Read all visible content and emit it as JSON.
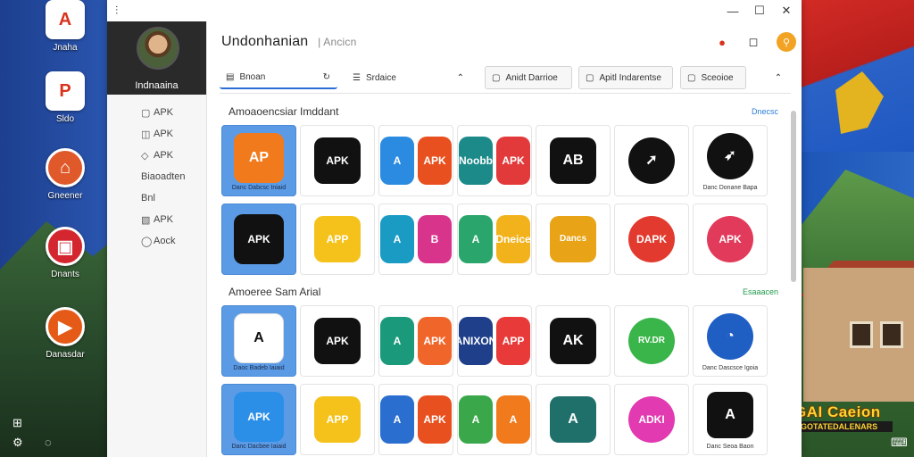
{
  "desktop": {
    "icons": [
      {
        "name": "desktop-icon-apk",
        "glyph": "A",
        "label": "Jnaha",
        "color": "#d9331e"
      },
      {
        "name": "desktop-icon-ap",
        "glyph": "P",
        "label": "Sldo",
        "color": "#d9331e"
      },
      {
        "name": "desktop-icon-store",
        "glyph": "⌂",
        "label": "Gneener",
        "color": "#e0592b"
      },
      {
        "name": "desktop-icon-box",
        "glyph": "▣",
        "label": "Dnants",
        "color": "#d3262f"
      },
      {
        "name": "desktop-icon-play",
        "glyph": "▶",
        "label": "Danasdar",
        "color": "#e55a17"
      }
    ],
    "caption": "AIGAI Caeion",
    "caption_sub": "IMANGOTATEDALENARS"
  },
  "window": {
    "title_glyph": "⫶",
    "controls": {
      "minimize": "—",
      "maximize": "☐",
      "close": "✕"
    }
  },
  "sidebar": {
    "user_name": "Indnaaina",
    "items": [
      {
        "icon": "▢",
        "label": "APK"
      },
      {
        "icon": "◫",
        "label": "APK"
      },
      {
        "icon": "◇",
        "label": "APK"
      },
      {
        "icon": "",
        "label": "Biaoadten"
      },
      {
        "icon": "",
        "label": "Bnl"
      },
      {
        "icon": "▧",
        "label": "APK"
      },
      {
        "icon": "◯",
        "label": "Aock"
      }
    ]
  },
  "header": {
    "title": "Undonhanian",
    "subtitle": "| Ancicn",
    "icons": {
      "notification": "●",
      "bell": "◻",
      "user": "⚲"
    }
  },
  "toolbar": {
    "tabs": [
      {
        "icon": "▤",
        "label": "Bnoan",
        "trail": "↻"
      },
      {
        "icon": "☰",
        "label": "Srdaice",
        "trail": "⌃"
      },
      {
        "icon": "▢",
        "label": "Anidt Darrioe",
        "trail": ""
      },
      {
        "icon": "▢",
        "label": "Apitl Indarentse",
        "trail": ""
      },
      {
        "icon": "▢",
        "label": "Sceoioe",
        "trail": ""
      }
    ],
    "collapse": "⌃"
  },
  "sections": [
    {
      "title": "Amoaoencsiar Imddant",
      "link": "Dnecsc",
      "rows": [
        [
          {
            "type": "featured",
            "text": "AP",
            "bg": "#f07a1c",
            "cap": "Danc Dabcsc Iniaid"
          },
          {
            "type": "icon",
            "text": "APK",
            "bg": "#111111"
          },
          {
            "type": "pair",
            "a": {
              "text": "A",
              "bg": "#2a8be0"
            },
            "b": {
              "text": "APK",
              "bg": "#e8501f"
            }
          },
          {
            "type": "pair",
            "a": {
              "text": "Noobb",
              "bg": "#1d8a8a"
            },
            "b": {
              "text": "APK",
              "bg": "#e23a3a"
            }
          },
          {
            "type": "icon",
            "text": "AB",
            "bg": "#111111"
          },
          {
            "type": "icon",
            "text": "➚",
            "bg": "#111111",
            "round": true
          },
          {
            "type": "icon",
            "text": "➶",
            "bg": "#111111",
            "round": true,
            "cap": "Danc Donane Bapa"
          }
        ],
        [
          {
            "type": "featured",
            "text": "APK",
            "bg": "#111111",
            "cap": ""
          },
          {
            "type": "icon",
            "text": "APP",
            "bg": "#f5c21b"
          },
          {
            "type": "pair",
            "a": {
              "text": "A",
              "bg": "#1a9bc4"
            },
            "b": {
              "text": "B",
              "bg": "#d8348c"
            }
          },
          {
            "type": "pair",
            "a": {
              "text": "A",
              "bg": "#2aa56b"
            },
            "b": {
              "text": "Dneice",
              "bg": "#f2b21c"
            }
          },
          {
            "type": "icon",
            "text": "Dancs",
            "bg": "#e8a317"
          },
          {
            "type": "icon",
            "text": "DAPK",
            "bg": "#e23a2e",
            "round": true
          },
          {
            "type": "icon",
            "text": "APK",
            "bg": "#e23a5a",
            "round": true
          }
        ]
      ]
    },
    {
      "title": "Amoeree Sam Arial",
      "link": "Esaaacen",
      "rows": [
        [
          {
            "type": "featured",
            "text": "A",
            "bg": "#ffffff",
            "cap": "Daoc Badeb Iaiaid"
          },
          {
            "type": "icon",
            "text": "APK",
            "bg": "#111111"
          },
          {
            "type": "pair",
            "a": {
              "text": "A",
              "bg": "#1a9a7a"
            },
            "b": {
              "text": "APK",
              "bg": "#f0652a"
            }
          },
          {
            "type": "pair",
            "a": {
              "text": "ANIXON",
              "bg": "#1f3f8a"
            },
            "b": {
              "text": "APP",
              "bg": "#e93a3a"
            }
          },
          {
            "type": "icon",
            "text": "AK",
            "bg": "#111111"
          },
          {
            "type": "icon",
            "text": "RV.DR",
            "bg": "#3ab54a",
            "round": true
          },
          {
            "type": "icon",
            "text": "◔",
            "bg": "#1f5fc4",
            "round": true,
            "cap": "Danc Dascsce Igoia"
          }
        ],
        [
          {
            "type": "featured",
            "text": "APK",
            "bg": "#2b8fe8",
            "cap": "Danc Dacbee Iaiaid"
          },
          {
            "type": "icon",
            "text": "APP",
            "bg": "#f5c21b"
          },
          {
            "type": "pair",
            "a": {
              "text": "A",
              "bg": "#2a6fd0"
            },
            "b": {
              "text": "APK",
              "bg": "#e8501f"
            }
          },
          {
            "type": "pair",
            "a": {
              "text": "A",
              "bg": "#3aa84a"
            },
            "b": {
              "text": "A",
              "bg": "#f07a1c"
            }
          },
          {
            "type": "icon",
            "text": "A",
            "bg": "#1f6f6a"
          },
          {
            "type": "icon",
            "text": "ADKI",
            "bg": "#e23ab0",
            "round": true
          },
          {
            "type": "icon",
            "text": "A",
            "bg": "#111111",
            "cap": "Danc Seoa Baon"
          }
        ]
      ]
    }
  ]
}
